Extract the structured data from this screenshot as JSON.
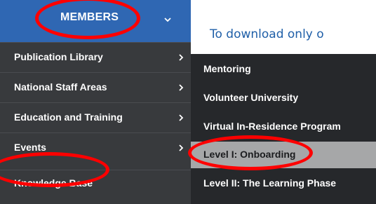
{
  "header": {
    "members_label": "MEMBERS",
    "chevron_icon": "chevron-down-icon"
  },
  "hint_text": "To download only o",
  "sidebar": {
    "items": [
      {
        "label": "Publication Library",
        "icon": "chevron-right-icon"
      },
      {
        "label": "National Staff Areas",
        "icon": "chevron-right-icon"
      },
      {
        "label": "Education and Training",
        "icon": "chevron-right-icon"
      },
      {
        "label": "Events",
        "icon": "chevron-right-icon"
      },
      {
        "label": "Knowledge Base"
      }
    ]
  },
  "submenu": {
    "items": [
      {
        "label": "Mentoring"
      },
      {
        "label": "Volunteer University"
      },
      {
        "label": "Virtual In-Residence Program"
      },
      {
        "label": "Level I: Onboarding",
        "active": true
      },
      {
        "label": "Level II: The Learning Phase"
      }
    ]
  },
  "colors": {
    "header_bg": "#2f67b3",
    "sidebar_bg": "#383a3d",
    "submenu_bg": "#26282b",
    "active_bg": "#a6a7a8",
    "annotation": "#ff0000",
    "hint_text": "#1f5fa8"
  }
}
